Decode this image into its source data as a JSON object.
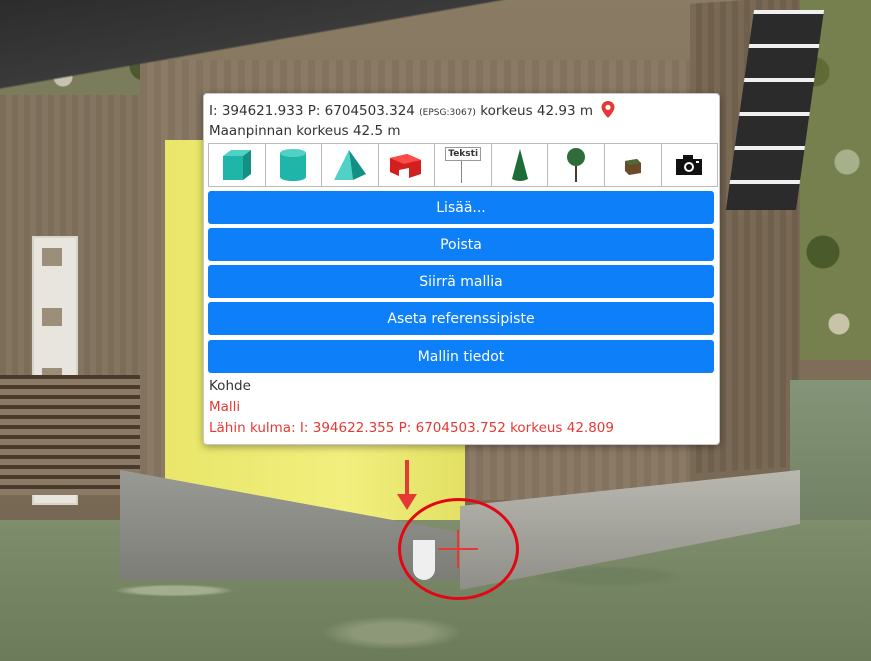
{
  "info": {
    "coords_text": "I: 394621.933 P: 6704503.324",
    "epsg": "(EPSG:3067)",
    "height_text": "korkeus 42.93 m",
    "ground_height": "Maanpinnan korkeus 42.5 m"
  },
  "toolbar": {
    "tools": [
      "cube-tool",
      "cylinder-tool",
      "pyramid-tool",
      "custom-shape-tool",
      "text-tool",
      "cone-tool",
      "tree-tool",
      "block-tool",
      "camera-tool"
    ],
    "text_tool_label": "Teksti"
  },
  "buttons": {
    "add": "Lisää...",
    "remove": "Poista",
    "move_model": "Siirrä mallia",
    "set_reference": "Aseta referenssipiste",
    "model_info": "Mallin tiedot"
  },
  "target": {
    "label": "Kohde",
    "model": "Malli",
    "nearest_corner": "Lähin kulma: I: 394622.355 P: 6704503.752 korkeus 42.809"
  },
  "colors": {
    "button": "#0d7ff8",
    "accent_red": "#e53935",
    "teal_shapes": "#1fb5a8"
  }
}
